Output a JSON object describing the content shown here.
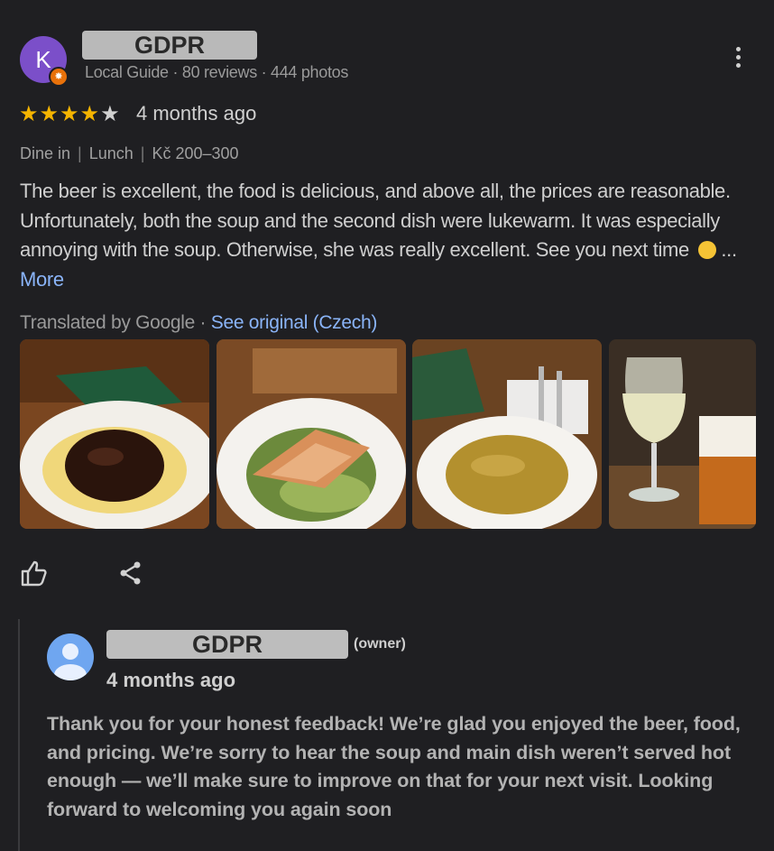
{
  "review": {
    "avatar_letter": "K",
    "reviewer_name": "GDPR",
    "meta": "Local Guide · 80 reviews · 444 photos",
    "rating": 4,
    "max_rating": 5,
    "date": "4 months ago",
    "tags": [
      "Dine in",
      "Lunch",
      "Kč 200–300"
    ],
    "text": "The beer is excellent, the food is delicious, and above all, the prices are reasonable. Unfortunately, both the soup and the second dish were lukewarm. It was especially annoying with the soup. Otherwise, she was really excellent. See you next time",
    "ellipsis": "...",
    "more_label": "More",
    "translated_by": "Translated by Google ·",
    "see_original": "See original (Czech)"
  },
  "photos": [
    {
      "icon": "dish-photo"
    },
    {
      "icon": "salad-photo"
    },
    {
      "icon": "soup-photo"
    },
    {
      "icon": "drinks-photo"
    }
  ],
  "actions": {
    "like_icon": "thumbs-up-icon",
    "share_icon": "share-icon"
  },
  "owner_reply": {
    "owner_name": "GDPR",
    "owner_tag": "(owner)",
    "date": "4 months ago",
    "text": "Thank you for your honest feedback! We’re glad you enjoyed the beer, food, and pricing. We’re sorry to hear the soup and main dish weren’t served hot enough — we’ll make sure to improve on that for your next visit. Looking forward to welcoming you again soon"
  },
  "colors": {
    "background": "#1f1f22",
    "star": "#f4b400",
    "link": "#8ab4f8",
    "reviewer_avatar": "#7b4fc9",
    "owner_avatar": "#6fa6f0"
  }
}
